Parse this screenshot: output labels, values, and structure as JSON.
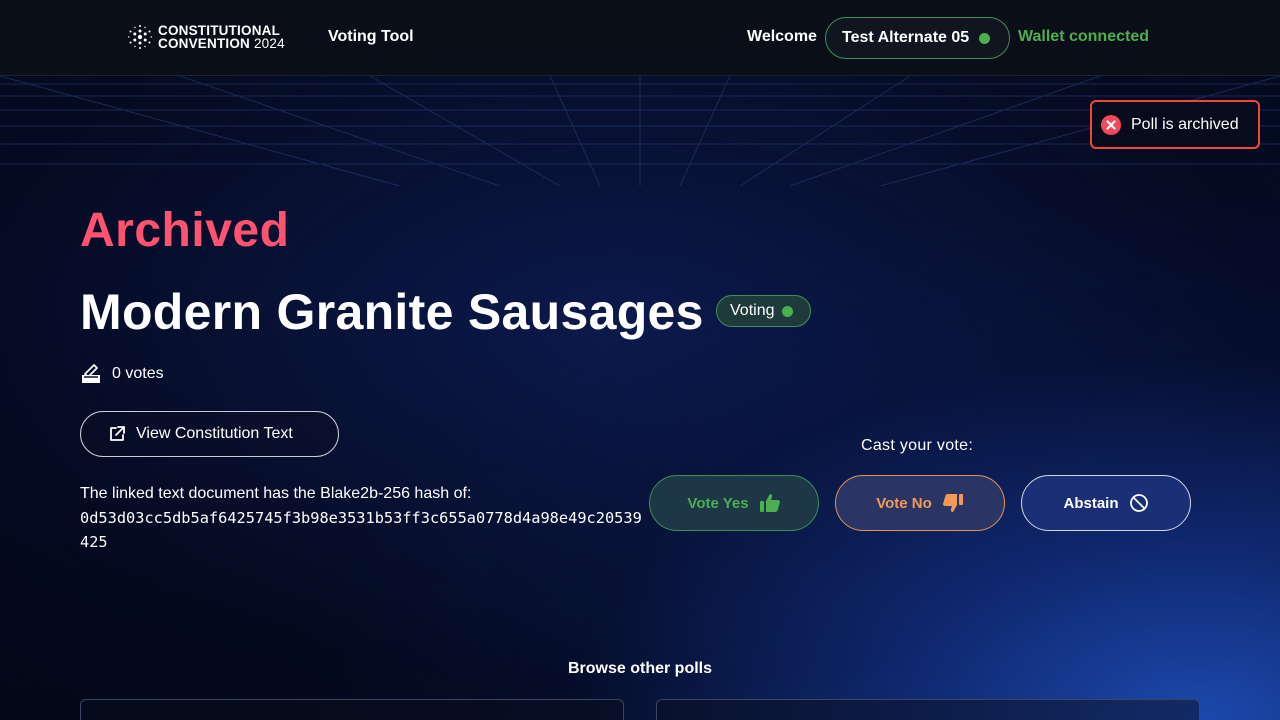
{
  "header": {
    "logo_line1": "CONSTITUTIONAL",
    "logo_line2": "CONVENTION",
    "logo_year": "2024",
    "app_title": "Voting Tool",
    "welcome_label": "Welcome",
    "user_name": "Test Alternate 05",
    "wallet_status": "Wallet connected"
  },
  "toast": {
    "message": "Poll is archived"
  },
  "poll": {
    "archived_label": "Archived",
    "title": "Modern Granite Sausages",
    "status_badge": "Voting",
    "votes_text": "0 votes",
    "view_button_label": "View Constitution Text",
    "hash_intro": "The linked text document has the Blake2b-256 hash of:",
    "hash_value": "0d53d03cc5db5af6425745f3b98e3531b53ff3c655a0778d4a98e49c20539425"
  },
  "voting": {
    "cast_label": "Cast your vote:",
    "yes_label": "Vote Yes",
    "no_label": "Vote No",
    "abstain_label": "Abstain"
  },
  "browse": {
    "title": "Browse other polls"
  },
  "colors": {
    "archived_red": "#ff5370",
    "status_green": "#4caf50",
    "vote_no_orange": "#f39a55",
    "toast_border": "#f0473d"
  },
  "icons": {
    "logo": "cardano-dots-icon",
    "status_dot": "green-dot-icon",
    "toast": "x-circle-icon",
    "votes": "ballot-box-icon",
    "view": "external-link-icon",
    "yes": "thumbs-up-icon",
    "no": "thumbs-down-icon",
    "abstain": "ban-icon"
  }
}
